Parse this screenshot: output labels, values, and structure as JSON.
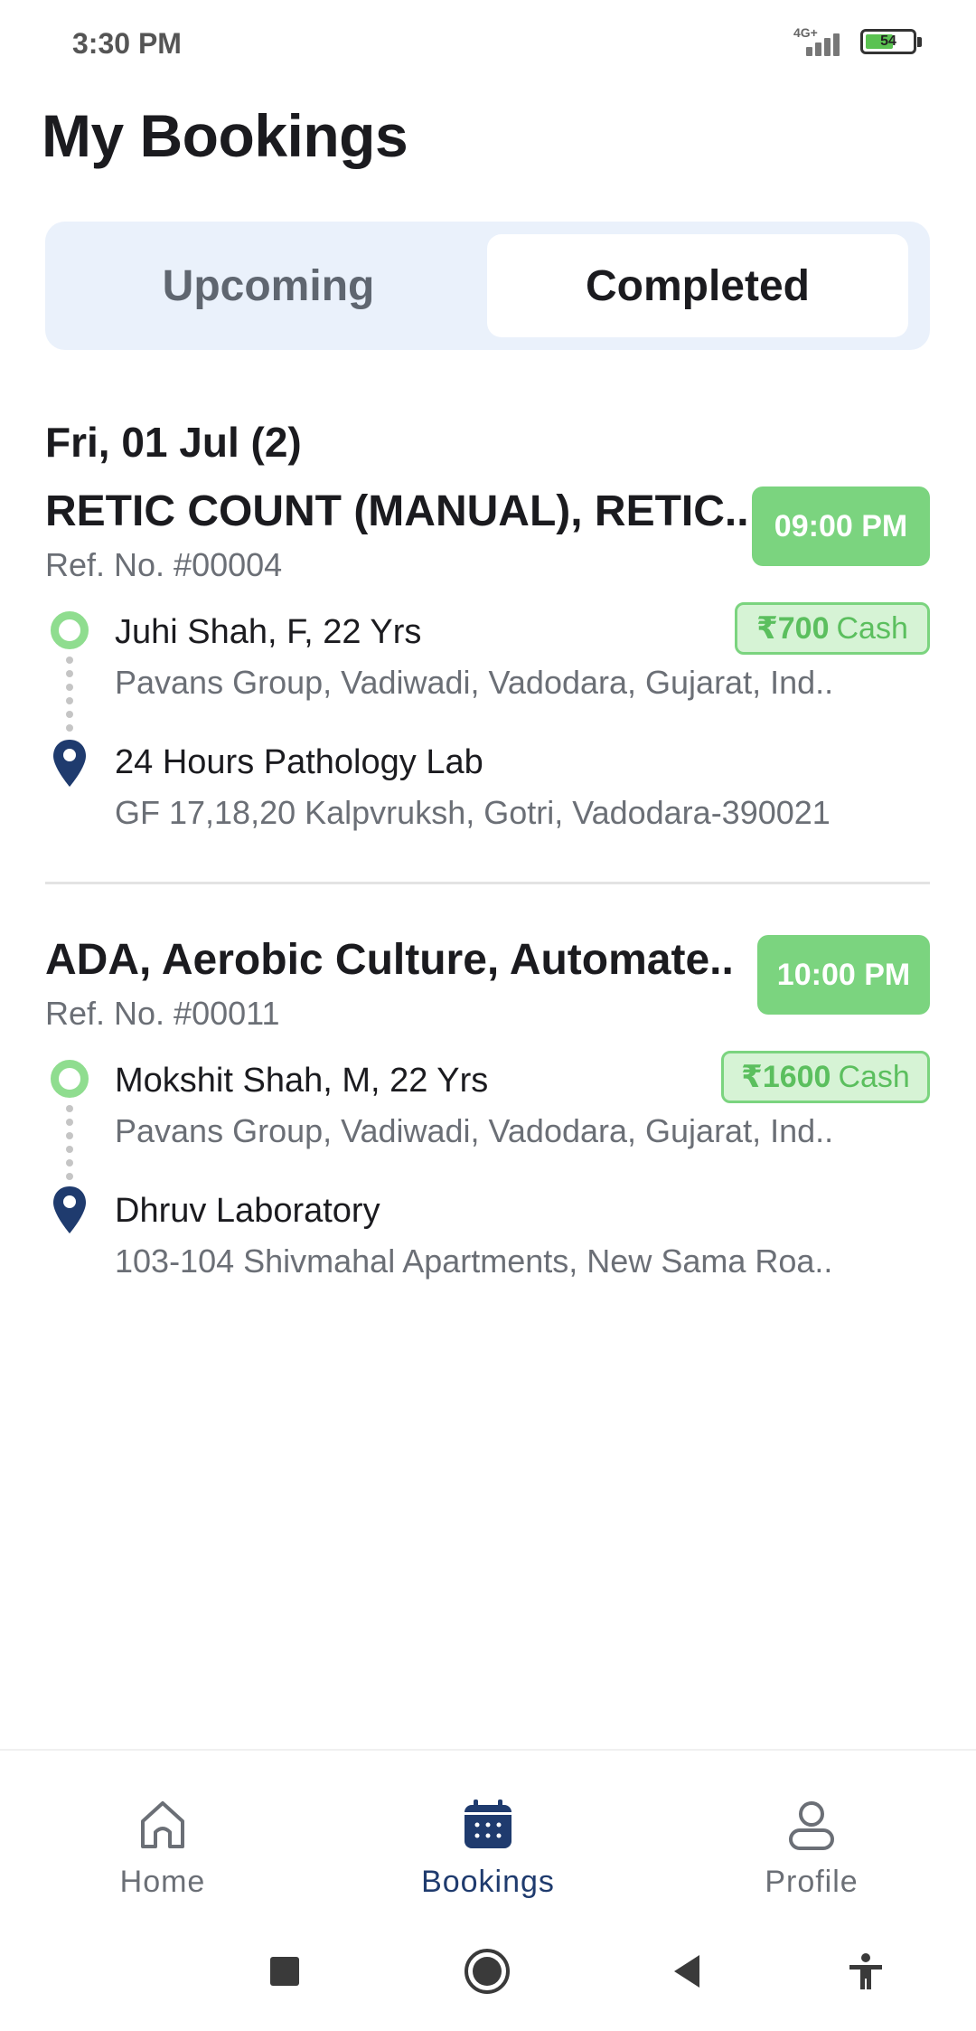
{
  "status_bar": {
    "time": "3:30 PM",
    "network": "4G+",
    "battery": "54",
    "battery_level": 0.54
  },
  "page": {
    "title": "My Bookings"
  },
  "tabs": [
    {
      "label": "Upcoming",
      "selected": false
    },
    {
      "label": "Completed",
      "selected": true
    }
  ],
  "section": {
    "date": "Fri, 01 Jul (2)"
  },
  "bookings": [
    {
      "title": "RETIC COUNT (MANUAL), RETIC..",
      "time": "09:00 PM",
      "ref": "Ref. No. #00004",
      "price_amount": "₹700",
      "price_method": "Cash",
      "patient": "Juhi Shah, F, 22 Yrs",
      "patient_address": "Pavans Group, Vadiwadi, Vadodara, Gujarat, Ind..",
      "lab_name": "24 Hours Pathology Lab",
      "lab_address": "GF 17,18,20 Kalpvruksh, Gotri, Vadodara-390021"
    },
    {
      "title": "ADA, Aerobic Culture, Automate..",
      "time": "10:00 PM",
      "ref": "Ref. No. #00011",
      "price_amount": "₹1600",
      "price_method": "Cash",
      "patient": "Mokshit Shah, M, 22 Yrs",
      "patient_address": "Pavans Group, Vadiwadi, Vadodara, Gujarat, Ind..",
      "lab_name": "Dhruv Laboratory",
      "lab_address": "103-104 Shivmahal Apartments, New Sama Roa.."
    }
  ],
  "bottom_nav": [
    {
      "label": "Home",
      "icon": "home-icon",
      "active": false
    },
    {
      "label": "Bookings",
      "icon": "calendar-icon",
      "active": true
    },
    {
      "label": "Profile",
      "icon": "profile-icon",
      "active": false
    }
  ],
  "colors": {
    "accent_green": "#7bd47f",
    "nav_active": "#1f3b6e",
    "pin_blue": "#1f3b6e",
    "tab_bg": "#eaf1fb"
  }
}
